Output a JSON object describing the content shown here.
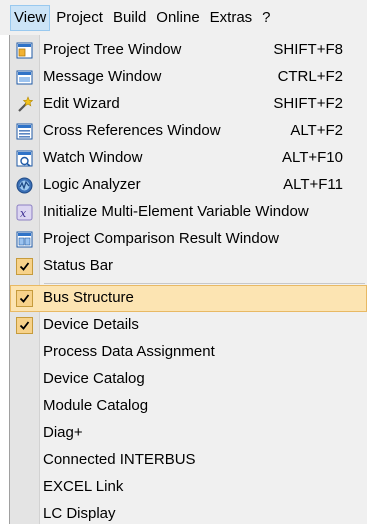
{
  "menubar": {
    "items": [
      {
        "label": "View"
      },
      {
        "label": "Project"
      },
      {
        "label": "Build"
      },
      {
        "label": "Online"
      },
      {
        "label": "Extras"
      },
      {
        "label": "?"
      }
    ]
  },
  "menu": {
    "items": [
      {
        "label": "Project Tree Window",
        "shortcut": "SHIFT+F8",
        "icon": "project-tree-icon"
      },
      {
        "label": "Message Window",
        "shortcut": "CTRL+F2",
        "icon": "message-window-icon"
      },
      {
        "label": "Edit Wizard",
        "shortcut": "SHIFT+F2",
        "icon": "wizard-wand-icon"
      },
      {
        "label": "Cross References Window",
        "shortcut": "ALT+F2",
        "icon": "cross-references-icon"
      },
      {
        "label": "Watch Window",
        "shortcut": "ALT+F10",
        "icon": "watch-window-icon"
      },
      {
        "label": "Logic Analyzer",
        "shortcut": "ALT+F11",
        "icon": "logic-analyzer-icon"
      },
      {
        "label": "Initialize Multi-Element Variable Window",
        "shortcut": "",
        "icon": "initialize-variable-icon"
      },
      {
        "label": "Project Comparison Result Window",
        "shortcut": "",
        "icon": "project-comparison-icon"
      },
      {
        "label": "Status Bar",
        "shortcut": "",
        "checked": true
      },
      {
        "label": "Bus Structure",
        "shortcut": "",
        "checked": true,
        "highlighted": true
      },
      {
        "label": "Device Details",
        "shortcut": "",
        "checked": true
      },
      {
        "label": "Process Data Assignment",
        "shortcut": ""
      },
      {
        "label": "Device Catalog",
        "shortcut": ""
      },
      {
        "label": "Module Catalog",
        "shortcut": ""
      },
      {
        "label": "Diag+",
        "shortcut": ""
      },
      {
        "label": "Connected INTERBUS",
        "shortcut": ""
      },
      {
        "label": "EXCEL Link",
        "shortcut": ""
      },
      {
        "label": "LC Display",
        "shortcut": ""
      }
    ]
  },
  "colors": {
    "menu_bg": "#f0f0f0",
    "highlight": "#fce4b2",
    "highlight_border": "#e8b964",
    "active_menubar": "#cce4f7"
  }
}
